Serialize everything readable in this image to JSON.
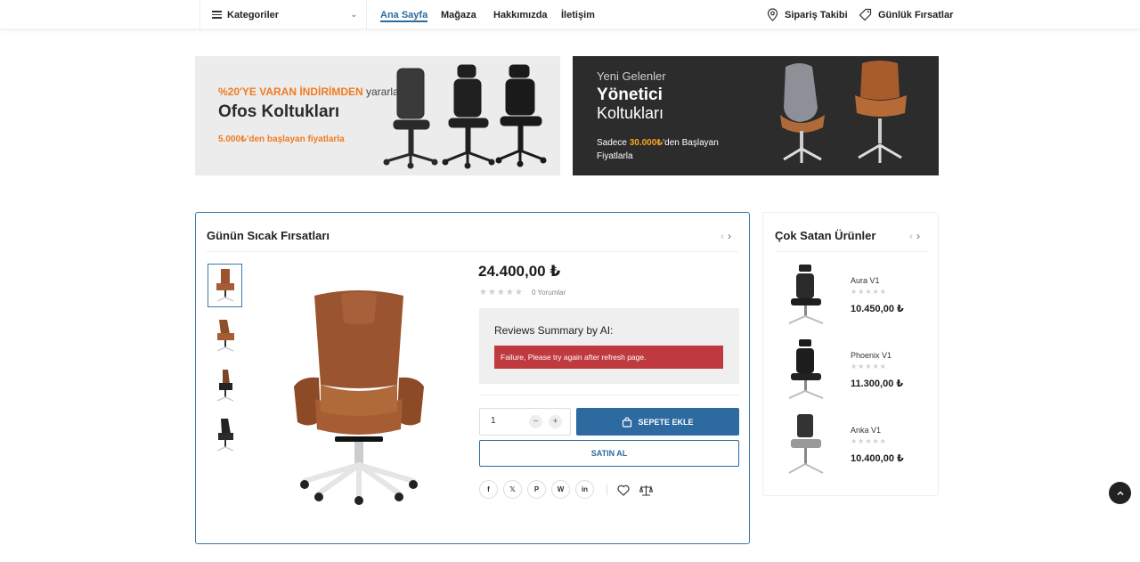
{
  "nav": {
    "categories_label": "Kategoriler",
    "links": [
      "Ana Sayfa",
      "Mağaza",
      "Hakkımızda",
      "İletişim"
    ],
    "order_tracking": "Sipariş Takibi",
    "daily_deals": "Günlük Fırsatlar"
  },
  "banner1": {
    "promo": "%20'YE VARAN İNDİRİMDEN",
    "promo_tail": "yararlanın",
    "title": "Ofos Koltukları",
    "subtitle": "5.000₺'den başlayan fiyatlarla"
  },
  "banner2": {
    "eyebrow": "Yeni Gelenler",
    "title_bold": "Yönetici",
    "title_light": "Koltukları",
    "sub_pre": "Sadece",
    "sub_price": "30.000₺",
    "sub_post": "'den Başlayan Fiyatlarla"
  },
  "deals": {
    "title": "Günün Sıcak Fırsatları",
    "price": "24.400,00 ₺",
    "rating_stars": "★★★★★",
    "review_count": "0 Yorumlar",
    "ai_title": "Reviews Summary by AI:",
    "ai_error": "Failure, Please try again after refresh page.",
    "qty": "1",
    "minus": "−",
    "plus": "+",
    "add_to_cart": "SEPETE EKLE",
    "buy_now": "SATIN AL",
    "share": [
      "f",
      "𝕏",
      "P",
      "W",
      "in"
    ]
  },
  "bestsellers": {
    "title": "Çok Satan Ürünler",
    "items": [
      {
        "name": "Aura V1",
        "price": "10.450,00 ₺",
        "stars": "★★★★★"
      },
      {
        "name": "Phoenix V1",
        "price": "11.300,00 ₺",
        "stars": "★★★★★"
      },
      {
        "name": "Anka V1",
        "price": "10.400,00 ₺",
        "stars": "★★★★★"
      }
    ]
  },
  "arrows": {
    "prev": "‹",
    "next": "›"
  },
  "colors": {
    "accent": "#2c6aa0",
    "promo_orange": "#f07b20",
    "error": "#bf3a3f",
    "dark_banner": "#2c2c2d"
  },
  "icons": [
    "menu-icon",
    "chevron-down-icon",
    "location-pin-icon",
    "price-tag-icon",
    "shopping-bag-icon",
    "heart-icon",
    "compare-icon",
    "arrow-up-icon"
  ]
}
